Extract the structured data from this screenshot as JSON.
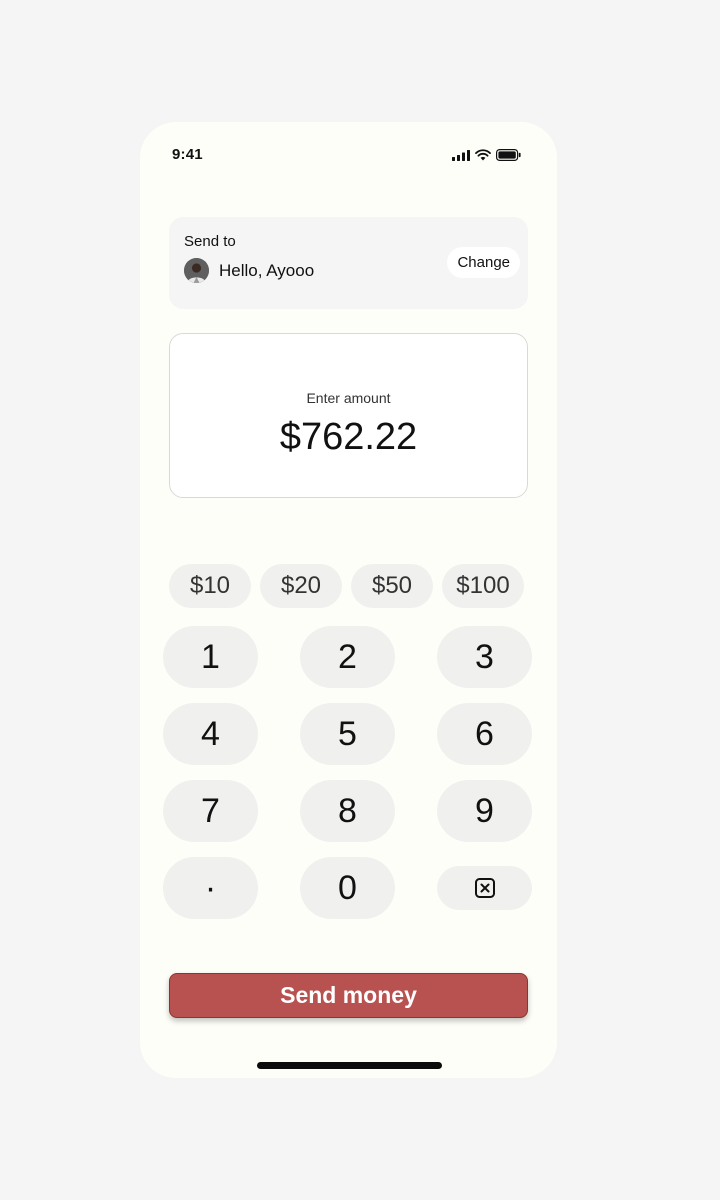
{
  "status_bar": {
    "time": "9:41",
    "icons": [
      "signal-icon",
      "wifi-icon",
      "battery-icon"
    ]
  },
  "send_to": {
    "label": "Send to",
    "recipient_name": "Hello, Ayooo",
    "change_label": "Change"
  },
  "amount": {
    "label": "Enter amount",
    "value": "$762.22"
  },
  "quick_amounts": [
    "$10",
    "$20",
    "$50",
    "$100"
  ],
  "keypad": {
    "keys": [
      "1",
      "2",
      "3",
      "4",
      "5",
      "6",
      "7",
      "8",
      "9",
      "·",
      "0"
    ],
    "backspace_icon": "backspace-icon"
  },
  "send_button": {
    "label": "Send money"
  },
  "colors": {
    "accent": "#b85250",
    "phone_background": "#fefef9",
    "page_background": "#f5f5f5",
    "key_background": "#f0f0ef"
  }
}
